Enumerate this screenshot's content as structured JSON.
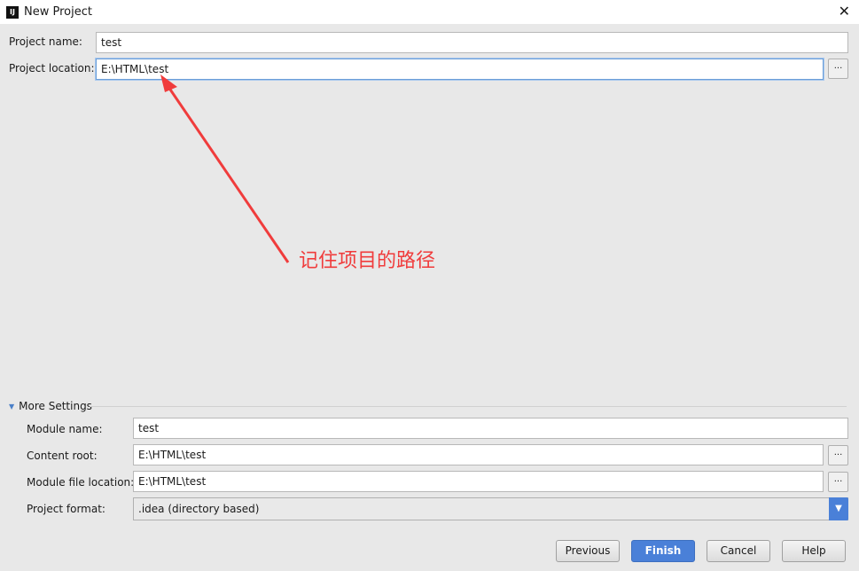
{
  "window": {
    "title": "New Project",
    "logo": "IJ",
    "close_icon": "close-icon"
  },
  "project_name": {
    "label": "Project name:",
    "value": "test"
  },
  "project_location": {
    "label": "Project location:",
    "value": "E:\\HTML\\test",
    "browse": "..."
  },
  "annotation": {
    "text": "记住项目的路径"
  },
  "more_settings": {
    "label": "More Settings",
    "module_name": {
      "label": "Module name:",
      "value": "test"
    },
    "content_root": {
      "label": "Content root:",
      "value": "E:\\HTML\\test",
      "browse": "..."
    },
    "module_file_location": {
      "label": "Module file location:",
      "value": "E:\\HTML\\test",
      "browse": "..."
    },
    "project_format": {
      "label": "Project format:",
      "value": ".idea (directory based)"
    }
  },
  "buttons": {
    "previous": "Previous",
    "finish": "Finish",
    "cancel": "Cancel",
    "help": "Help"
  },
  "colors": {
    "accent": "#4a80d8"
  }
}
